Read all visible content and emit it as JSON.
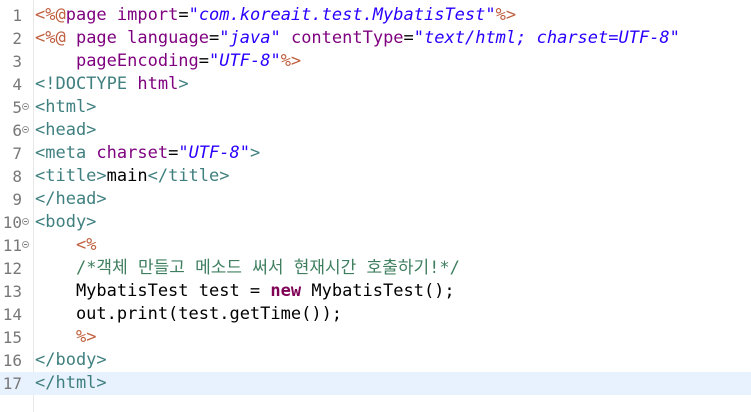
{
  "editor": {
    "lines": [
      {
        "n": "1",
        "fold": false,
        "tokens": [
          {
            "c": "jsp",
            "t": "<%@"
          },
          {
            "c": "attr",
            "t": "page "
          },
          {
            "c": "attr",
            "t": "import"
          },
          {
            "c": "",
            "t": "="
          },
          {
            "c": "str",
            "t": "\"com.koreait.test.MybatisTest\""
          },
          {
            "c": "jsp",
            "t": "%>"
          }
        ]
      },
      {
        "n": "2",
        "fold": false,
        "tokens": [
          {
            "c": "jsp",
            "t": "<%@ "
          },
          {
            "c": "attr",
            "t": "page "
          },
          {
            "c": "attr",
            "t": "language"
          },
          {
            "c": "",
            "t": "="
          },
          {
            "c": "str",
            "t": "\"java\""
          },
          {
            "c": "",
            "t": " "
          },
          {
            "c": "attr",
            "t": "contentType"
          },
          {
            "c": "",
            "t": "="
          },
          {
            "c": "str",
            "t": "\"text/html; charset=UTF-8\""
          }
        ]
      },
      {
        "n": "3",
        "fold": false,
        "tokens": [
          {
            "c": "",
            "t": "    "
          },
          {
            "c": "attr",
            "t": "pageEncoding"
          },
          {
            "c": "",
            "t": "="
          },
          {
            "c": "str",
            "t": "\"UTF-8\""
          },
          {
            "c": "jsp",
            "t": "%>"
          }
        ]
      },
      {
        "n": "4",
        "fold": false,
        "tokens": [
          {
            "c": "tag",
            "t": "<!DOCTYPE "
          },
          {
            "c": "attr",
            "t": "html"
          },
          {
            "c": "tag",
            "t": ">"
          }
        ]
      },
      {
        "n": "5",
        "fold": true,
        "tokens": [
          {
            "c": "tag",
            "t": "<html>"
          }
        ]
      },
      {
        "n": "6",
        "fold": true,
        "tokens": [
          {
            "c": "tag",
            "t": "<head>"
          }
        ]
      },
      {
        "n": "7",
        "fold": false,
        "tokens": [
          {
            "c": "tag",
            "t": "<meta "
          },
          {
            "c": "attr",
            "t": "charset"
          },
          {
            "c": "",
            "t": "="
          },
          {
            "c": "str",
            "t": "\"UTF-8\""
          },
          {
            "c": "tag",
            "t": ">"
          }
        ]
      },
      {
        "n": "8",
        "fold": false,
        "tokens": [
          {
            "c": "tag",
            "t": "<title>"
          },
          {
            "c": "",
            "t": "main"
          },
          {
            "c": "tag",
            "t": "</title>"
          }
        ]
      },
      {
        "n": "9",
        "fold": false,
        "tokens": [
          {
            "c": "tag",
            "t": "</head>"
          }
        ]
      },
      {
        "n": "10",
        "fold": true,
        "tokens": [
          {
            "c": "tag",
            "t": "<body>"
          }
        ]
      },
      {
        "n": "11",
        "fold": true,
        "tokens": [
          {
            "c": "",
            "t": "    "
          },
          {
            "c": "jsp",
            "t": "<%"
          }
        ]
      },
      {
        "n": "12",
        "fold": false,
        "tokens": [
          {
            "c": "",
            "t": "    "
          },
          {
            "c": "cmt",
            "t": "/*객체 만들고 메소드 써서 현재시간 호출하기!*/"
          }
        ]
      },
      {
        "n": "13",
        "fold": false,
        "tokens": [
          {
            "c": "",
            "t": "    MybatisTest test = "
          },
          {
            "c": "kw",
            "t": "new"
          },
          {
            "c": "",
            "t": " MybatisTest();"
          }
        ]
      },
      {
        "n": "14",
        "fold": false,
        "tokens": [
          {
            "c": "",
            "t": "    out.print(test.getTime());"
          }
        ]
      },
      {
        "n": "15",
        "fold": false,
        "tokens": [
          {
            "c": "",
            "t": "    "
          },
          {
            "c": "jsp",
            "t": "%>"
          }
        ]
      },
      {
        "n": "16",
        "fold": false,
        "tokens": [
          {
            "c": "tag",
            "t": "</body>"
          }
        ]
      },
      {
        "n": "17",
        "fold": false,
        "current": true,
        "tokens": [
          {
            "c": "tag",
            "t": "</html>"
          }
        ]
      }
    ]
  }
}
